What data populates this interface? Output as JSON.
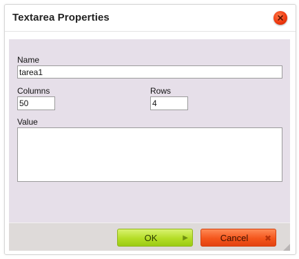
{
  "dialog": {
    "title": "Textarea Properties"
  },
  "form": {
    "name_label": "Name",
    "name_value": "tarea1",
    "columns_label": "Columns",
    "columns_value": "50",
    "rows_label": "Rows",
    "rows_value": "4",
    "value_label": "Value",
    "value_value": ""
  },
  "buttons": {
    "ok_label": "OK",
    "cancel_label": "Cancel"
  },
  "colors": {
    "content_bg": "#e6dfe9",
    "ok_green": "#b4dd27",
    "cancel_orange": "#f4561c",
    "close_red": "#f03a10"
  },
  "icons": {
    "close": "close-icon",
    "ok": "arrow-right-icon",
    "cancel": "x-icon",
    "resize": "resize-grip-icon"
  }
}
